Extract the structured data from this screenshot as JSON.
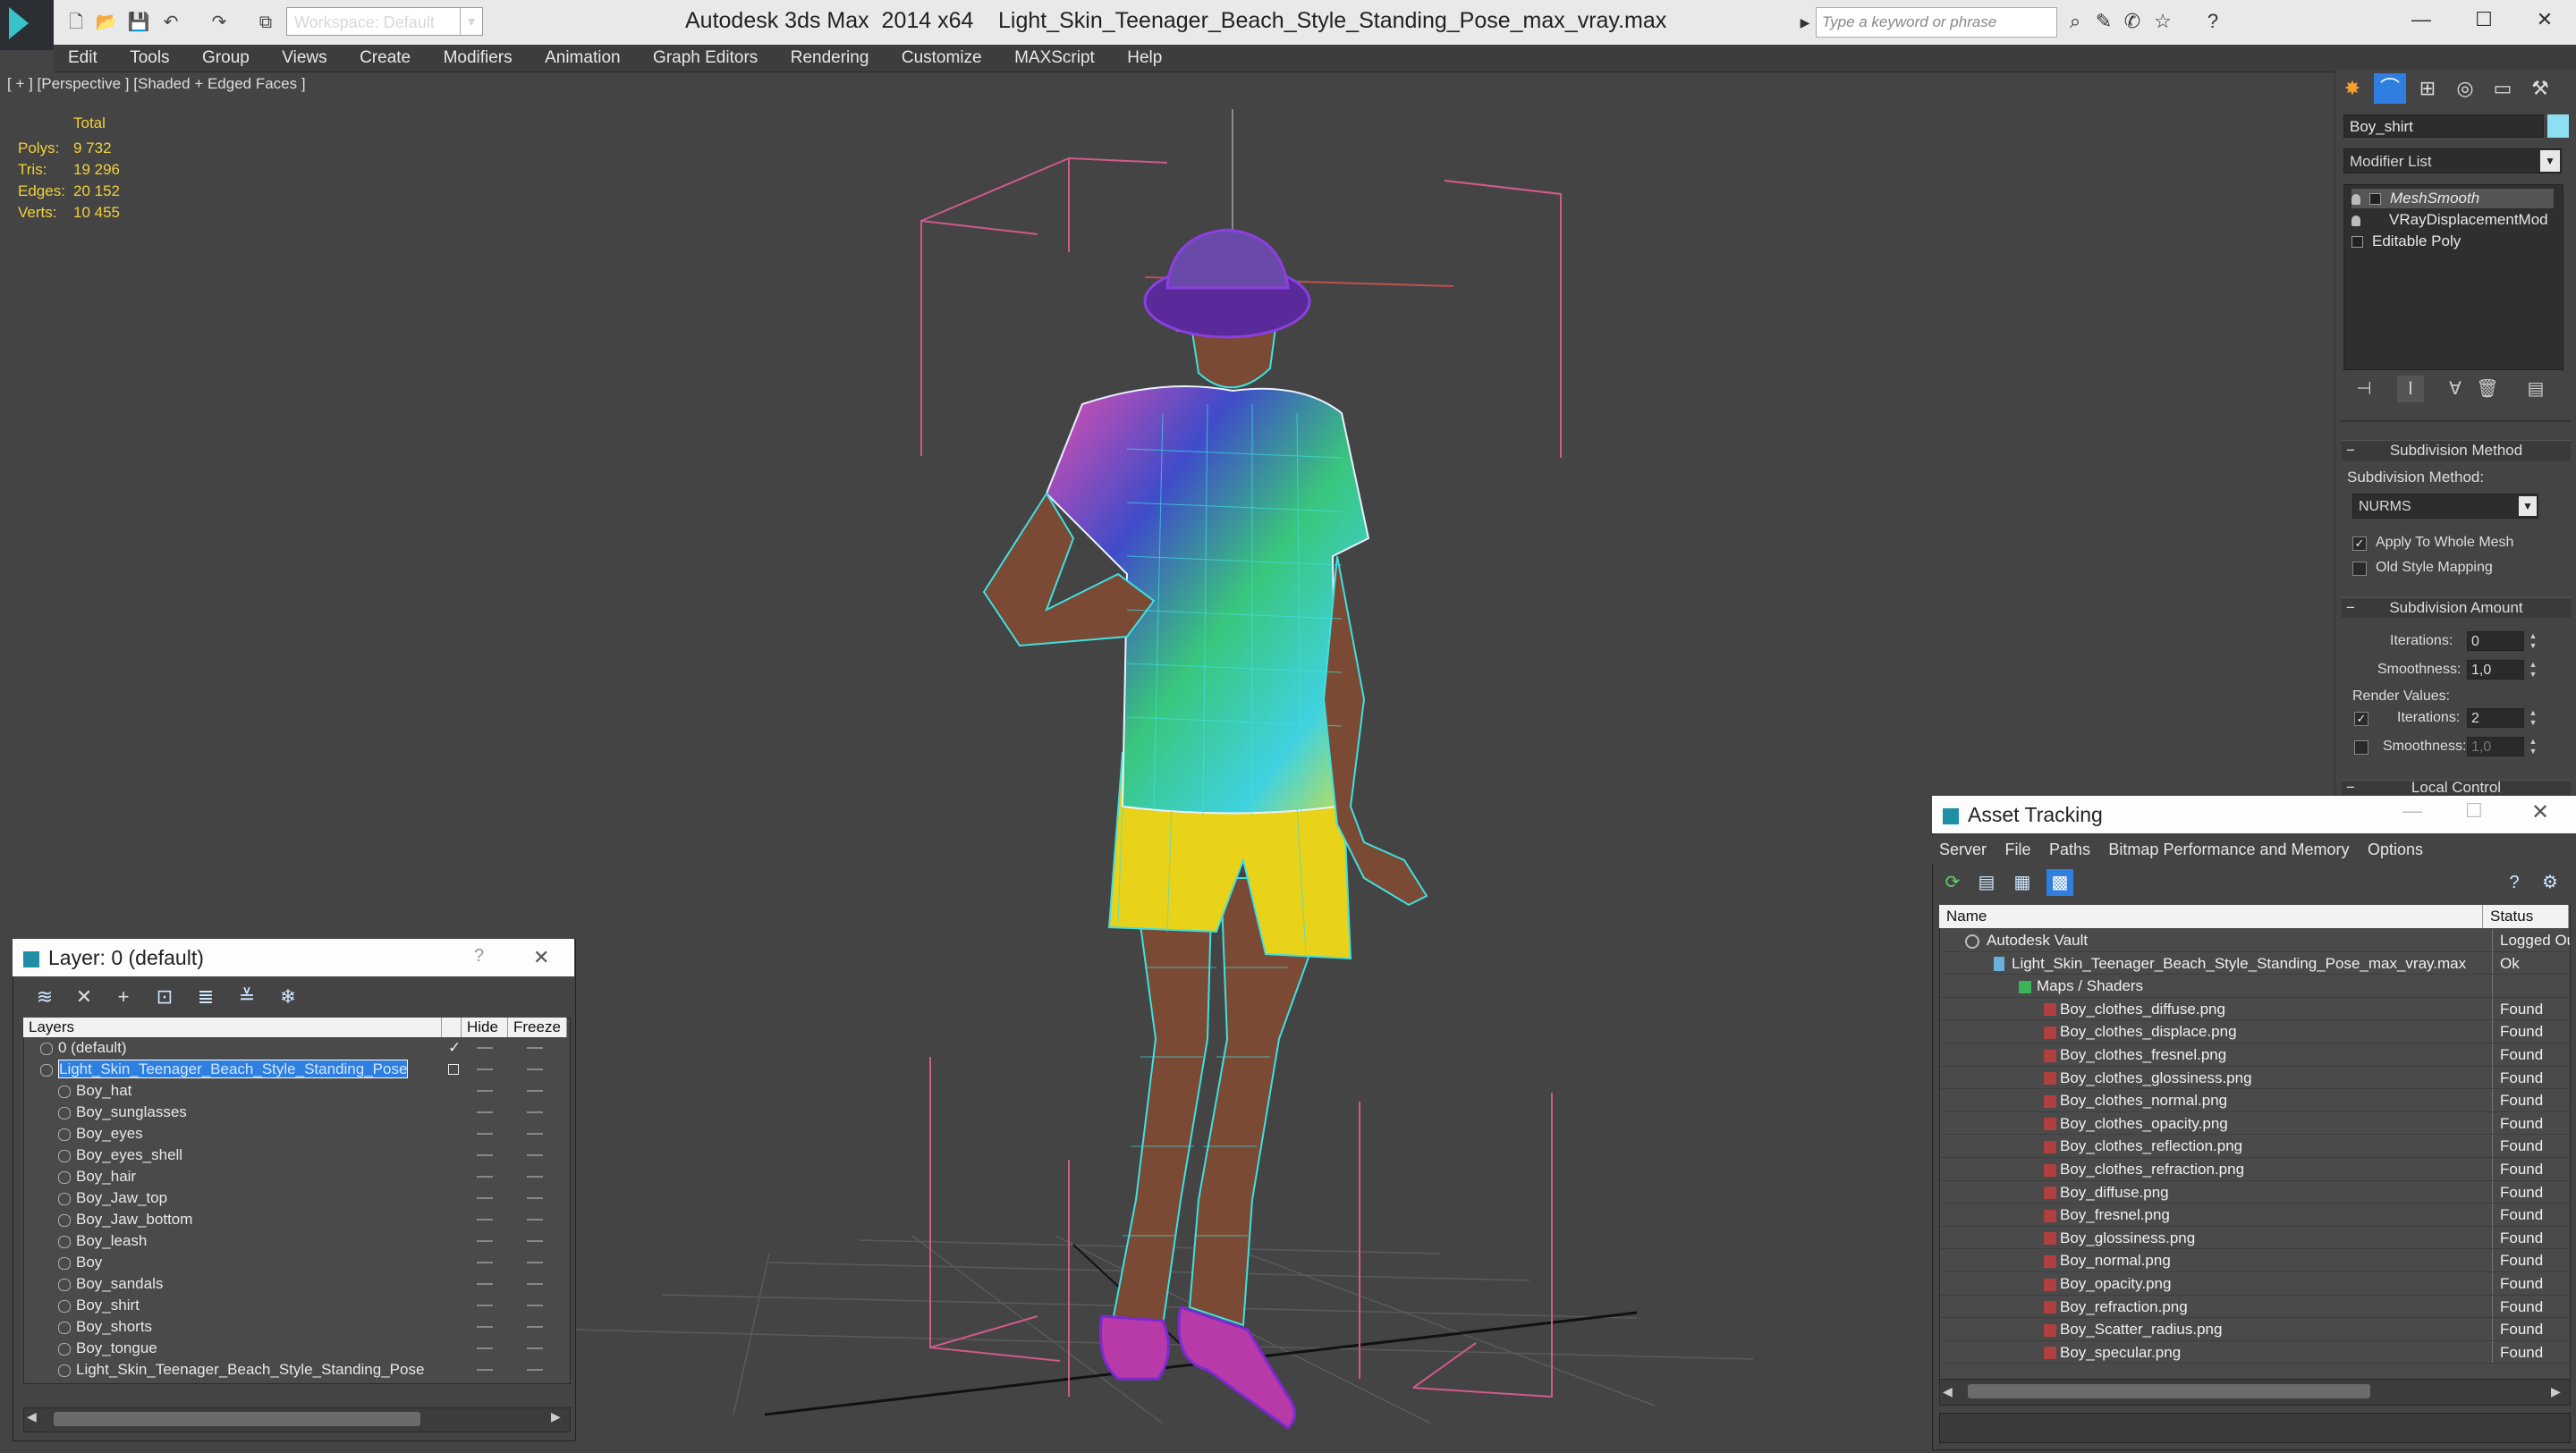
{
  "titlebar": {
    "workspace": "Workspace: Default",
    "app": "Autodesk 3ds Max  2014 x64",
    "file": "Light_Skin_Teenager_Beach_Style_Standing_Pose_max_vray.max",
    "search_placeholder": "Type a keyword or phrase"
  },
  "menu": [
    "Edit",
    "Tools",
    "Group",
    "Views",
    "Create",
    "Modifiers",
    "Animation",
    "Graph Editors",
    "Rendering",
    "Customize",
    "MAXScript",
    "Help"
  ],
  "viewport": {
    "label": "[ + ] [Perspective ] [Shaded + Edged Faces ]",
    "stats": {
      "total": "Total",
      "rows": [
        {
          "label": "Polys:",
          "value": "9 732"
        },
        {
          "label": "Tris:",
          "value": "19 296"
        },
        {
          "label": "Edges:",
          "value": "20 152"
        },
        {
          "label": "Verts:",
          "value": "10 455"
        }
      ]
    }
  },
  "command_panel": {
    "object_name": "Boy_shirt",
    "object_color": "#8fdff2",
    "modifier_list": "Modifier List",
    "stack": [
      "MeshSmooth",
      "VRayDisplacementMod",
      "Editable Poly"
    ],
    "subdivision_method_rollout": "Subdivision Method",
    "subdivision_method_label": "Subdivision Method:",
    "subdivision_method_value": "NURMS",
    "apply_whole_mesh": "Apply To Whole Mesh",
    "old_style_mapping": "Old Style Mapping",
    "subdivision_amount_rollout": "Subdivision Amount",
    "iterations_label": "Iterations:",
    "iterations_value": "0",
    "smoothness_label": "Smoothness:",
    "smoothness_value": "1,0",
    "render_values_label": "Render Values:",
    "render_iterations_label": "Iterations:",
    "render_iterations_value": "2",
    "render_smoothness_label": "Smoothness:",
    "render_smoothness_value": "1,0",
    "local_control_rollout": "Local Control"
  },
  "layer_window": {
    "title": "Layer: 0 (default)",
    "help": "?",
    "close": "✕",
    "columns": [
      "Layers",
      "Hide",
      "Freeze"
    ],
    "rows": [
      {
        "name": "0 (default)",
        "indent": 0
      },
      {
        "name": "Light_Skin_Teenager_Beach_Style_Standing_Pose",
        "indent": 0
      },
      {
        "name": "Boy_hat",
        "indent": 1
      },
      {
        "name": "Boy_sunglasses",
        "indent": 1
      },
      {
        "name": "Boy_eyes",
        "indent": 1
      },
      {
        "name": "Boy_eyes_shell",
        "indent": 1
      },
      {
        "name": "Boy_hair",
        "indent": 1
      },
      {
        "name": "Boy_Jaw_top",
        "indent": 1
      },
      {
        "name": "Boy_Jaw_bottom",
        "indent": 1
      },
      {
        "name": "Boy_leash",
        "indent": 1
      },
      {
        "name": "Boy",
        "indent": 1
      },
      {
        "name": "Boy_sandals",
        "indent": 1
      },
      {
        "name": "Boy_shirt",
        "indent": 1
      },
      {
        "name": "Boy_shorts",
        "indent": 1
      },
      {
        "name": "Boy_tongue",
        "indent": 1
      },
      {
        "name": "Light_Skin_Teenager_Beach_Style_Standing_Pose",
        "indent": 1
      }
    ]
  },
  "asset_window": {
    "title": "Asset Tracking",
    "menu": [
      "Server",
      "File",
      "Paths",
      "Bitmap Performance and Memory",
      "Options"
    ],
    "columns": [
      "Name",
      "Status"
    ],
    "rows": [
      {
        "name": "Autodesk Vault",
        "status": "Logged Out",
        "level": 0
      },
      {
        "name": "Light_Skin_Teenager_Beach_Style_Standing_Pose_max_vray.max",
        "status": "Ok",
        "level": 1
      },
      {
        "name": "Maps / Shaders",
        "status": "",
        "level": 2
      },
      {
        "name": "Boy_clothes_diffuse.png",
        "status": "Found",
        "level": 3
      },
      {
        "name": "Boy_clothes_displace.png",
        "status": "Found",
        "level": 3
      },
      {
        "name": "Boy_clothes_fresnel.png",
        "status": "Found",
        "level": 3
      },
      {
        "name": "Boy_clothes_glossiness.png",
        "status": "Found",
        "level": 3
      },
      {
        "name": "Boy_clothes_normal.png",
        "status": "Found",
        "level": 3
      },
      {
        "name": "Boy_clothes_opacity.png",
        "status": "Found",
        "level": 3
      },
      {
        "name": "Boy_clothes_reflection.png",
        "status": "Found",
        "level": 3
      },
      {
        "name": "Boy_clothes_refraction.png",
        "status": "Found",
        "level": 3
      },
      {
        "name": "Boy_diffuse.png",
        "status": "Found",
        "level": 3
      },
      {
        "name": "Boy_fresnel.png",
        "status": "Found",
        "level": 3
      },
      {
        "name": "Boy_glossiness.png",
        "status": "Found",
        "level": 3
      },
      {
        "name": "Boy_normal.png",
        "status": "Found",
        "level": 3
      },
      {
        "name": "Boy_opacity.png",
        "status": "Found",
        "level": 3
      },
      {
        "name": "Boy_refraction.png",
        "status": "Found",
        "level": 3
      },
      {
        "name": "Boy_Scatter_radius.png",
        "status": "Found",
        "level": 3
      },
      {
        "name": "Boy_specular.png",
        "status": "Found",
        "level": 3
      }
    ]
  }
}
